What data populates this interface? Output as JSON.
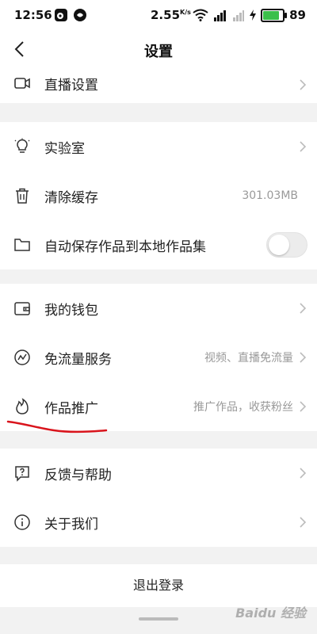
{
  "status_bar": {
    "time": "12:56",
    "speed": "2.55",
    "speed_unit": "K/s",
    "battery_level": "89",
    "battery_fraction": 0.89,
    "battery_color": "#3bbf4a"
  },
  "header": {
    "title": "设置"
  },
  "rows": {
    "live": {
      "label": "直播设置",
      "icon": "video-camera-icon"
    },
    "lab": {
      "label": "实验室",
      "icon": "light-bulb-icon"
    },
    "cache": {
      "label": "清除缓存",
      "value": "301.03MB",
      "icon": "trash-icon"
    },
    "autosave": {
      "label": "自动保存作品到本地作品集",
      "icon": "folder-icon",
      "toggle_on": false
    },
    "wallet": {
      "label": "我的钱包",
      "icon": "wallet-icon"
    },
    "free_data": {
      "label": "免流量服务",
      "value": "视频、直播免流量",
      "icon": "trend-wave-icon"
    },
    "promote": {
      "label": "作品推广",
      "value": "推广作品，收获粉丝",
      "icon": "flame-icon"
    },
    "feedback": {
      "label": "反馈与帮助",
      "icon": "question-bubble-icon"
    },
    "about": {
      "label": "关于我们",
      "icon": "info-circle-icon"
    }
  },
  "logout": {
    "label": "退出登录"
  },
  "annotation": {
    "underline_color": "#d9141c"
  },
  "watermark": {
    "text": "Baidu 经验"
  }
}
